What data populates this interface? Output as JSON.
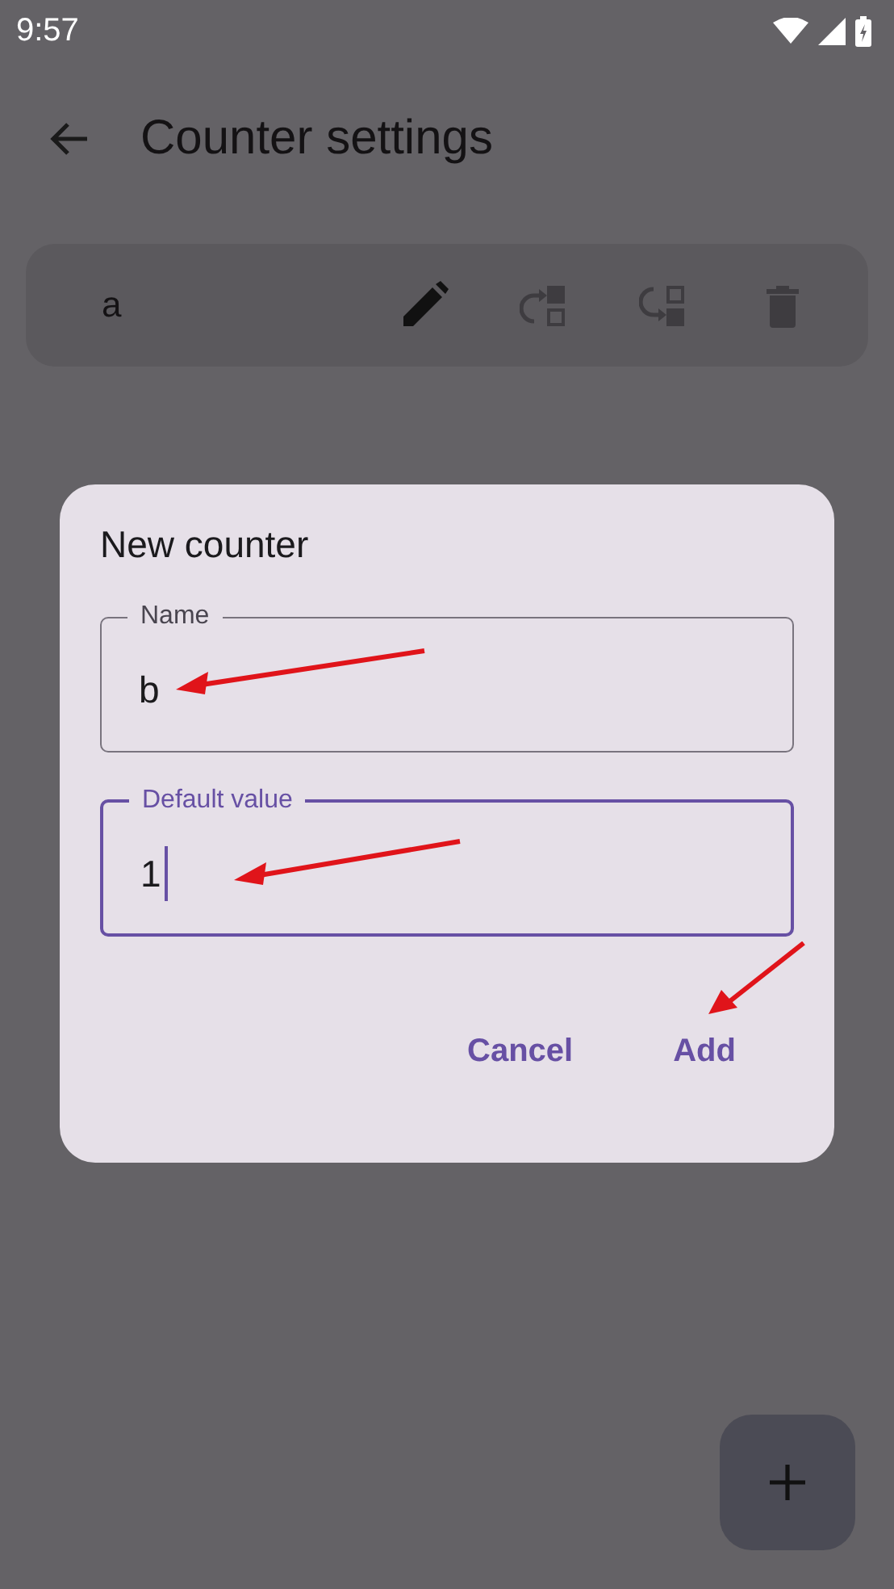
{
  "status_bar": {
    "time": "9:57"
  },
  "app_bar": {
    "title": "Counter settings"
  },
  "counters": [
    {
      "name": "a",
      "actions": [
        {
          "kind": "edit",
          "disabled": false
        },
        {
          "kind": "move_up",
          "disabled": true
        },
        {
          "kind": "move_down",
          "disabled": true
        },
        {
          "kind": "delete",
          "disabled": true
        }
      ]
    }
  ],
  "dialog": {
    "title": "New counter",
    "fields": [
      {
        "label": "Name",
        "value": "b",
        "focused": false
      },
      {
        "label": "Default value",
        "value": "1",
        "focused": true
      }
    ],
    "buttons": [
      "Cancel",
      "Add"
    ]
  }
}
